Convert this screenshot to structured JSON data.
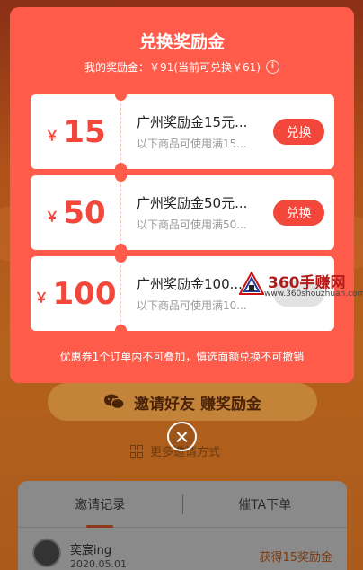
{
  "modal": {
    "title": "兑换奖励金",
    "balance_text": "我的奖励金：￥91(当前可兑换￥61)",
    "info_icon": "i",
    "note": "优惠券1个订单内不可叠加，慎选面额兑换不可撤销"
  },
  "coupons": [
    {
      "currency": "￥",
      "amount": "15",
      "title": "广州奖励金15元...",
      "desc": "以下商品可使用满15...",
      "button": "兑换"
    },
    {
      "currency": "￥",
      "amount": "50",
      "title": "广州奖励金50元...",
      "desc": "以下商品可使用满50...",
      "button": "兑换"
    },
    {
      "currency": "￥",
      "amount": "100",
      "title": "广州奖励金100...",
      "desc": "以下商品可使用满10...",
      "button": "兑换"
    }
  ],
  "page": {
    "invite_button": "邀请好友 赚奖励金",
    "more_ways": "更多邀请方式",
    "tabs": [
      "邀请记录",
      "催TA下单"
    ],
    "record": {
      "name": "奕宸ing",
      "date": "2020.05.01",
      "reward": "获得15奖励金"
    }
  },
  "watermark": {
    "main": "360手赚网",
    "sub": "www.360shouzhuan.com"
  }
}
